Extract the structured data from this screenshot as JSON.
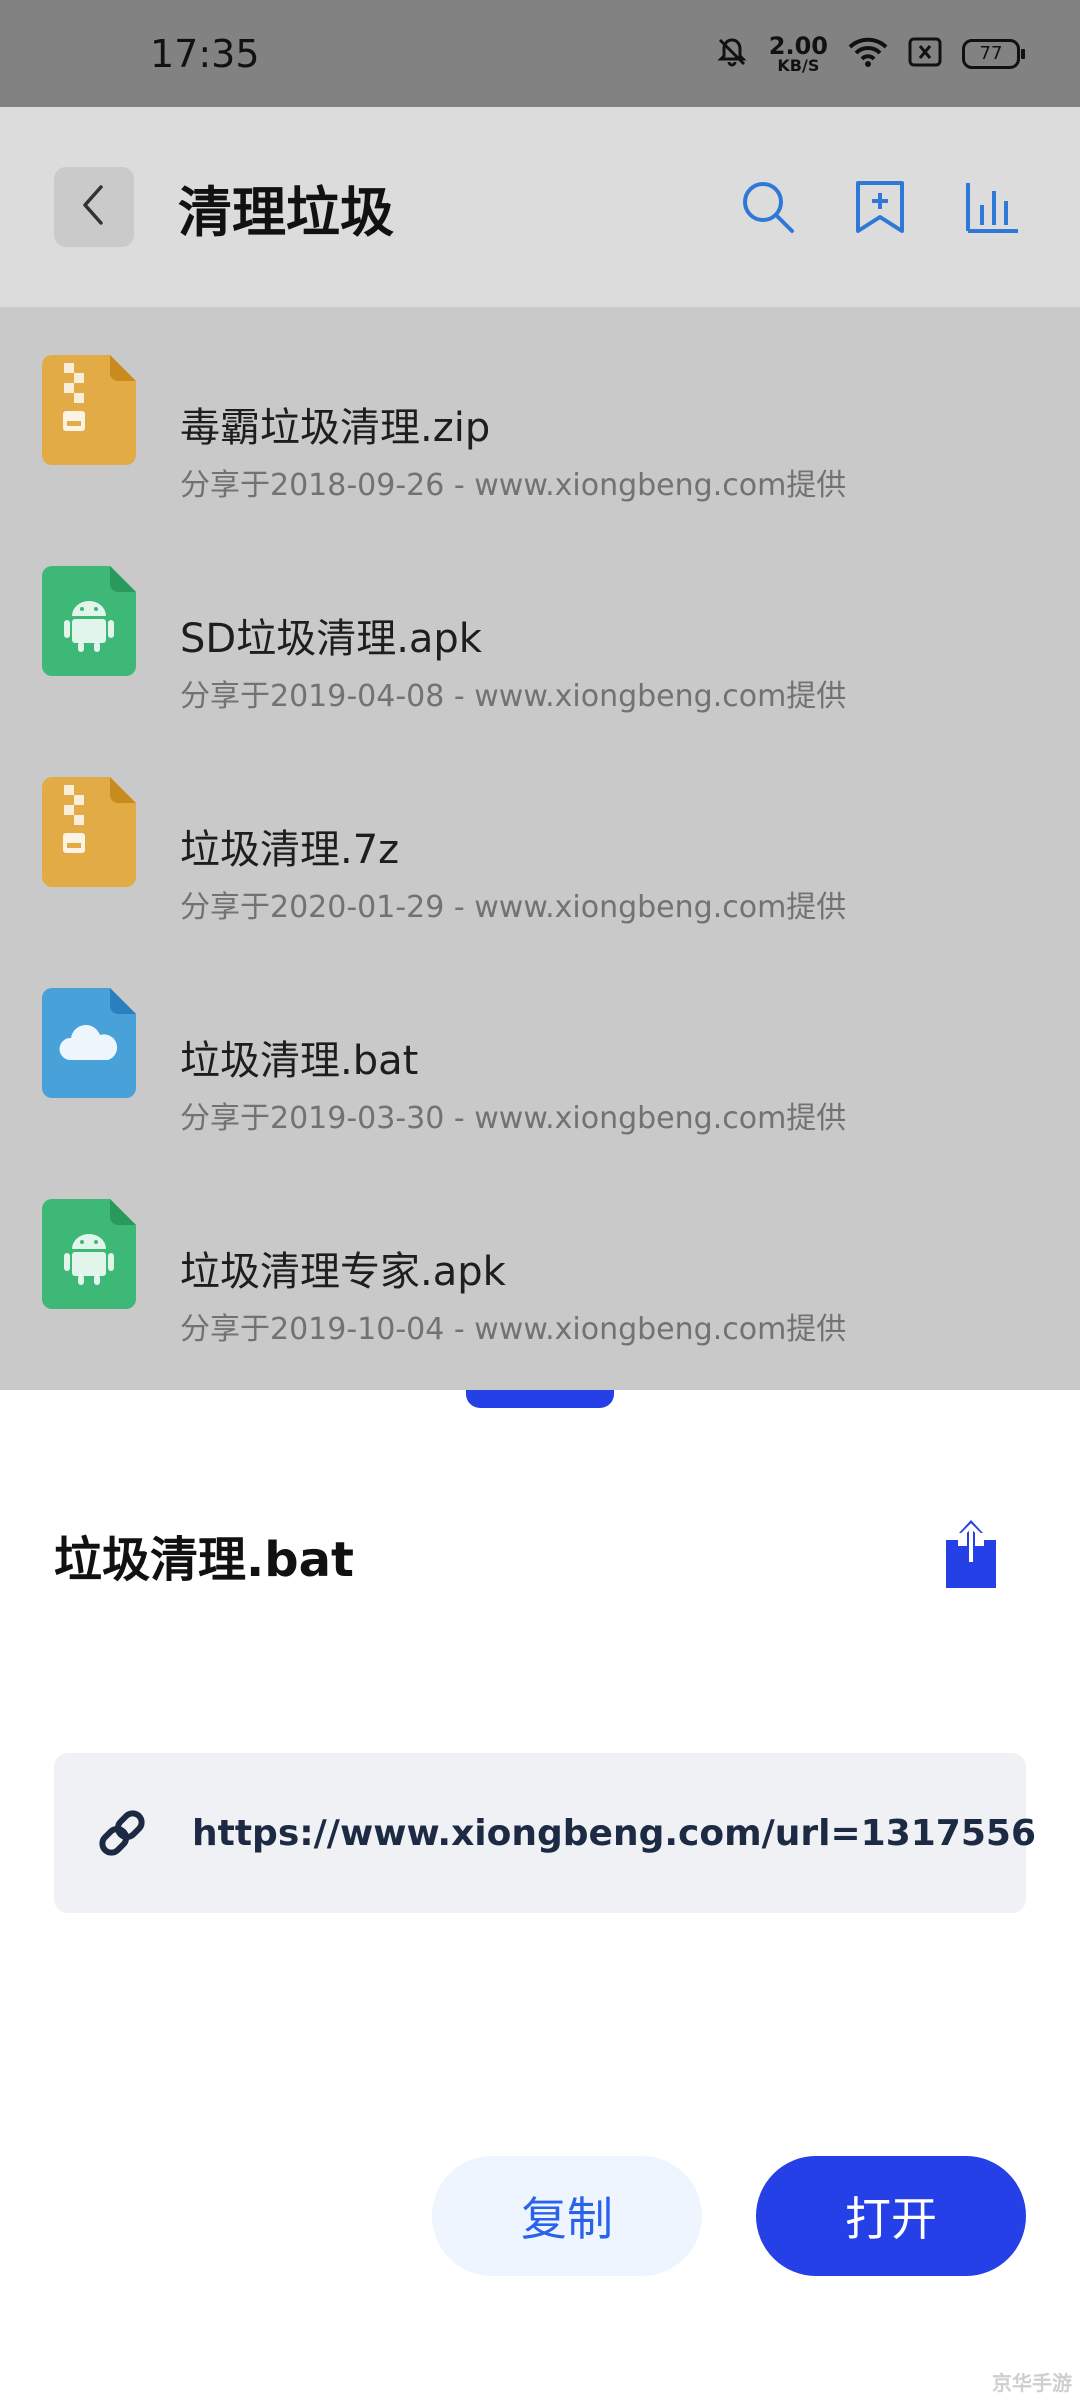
{
  "status_bar": {
    "time": "17:35",
    "net_speed": "2.00",
    "net_unit": "KB/S",
    "battery": "77"
  },
  "toolbar": {
    "title": "清理垃圾",
    "icons": [
      "back-icon",
      "search-icon",
      "bookmark-add-icon",
      "stats-icon"
    ],
    "accent": "#2f78d8"
  },
  "files": [
    {
      "name": "毒霸垃圾清理.zip",
      "meta": "分享于2018-09-26 - www.xiongbeng.com提供",
      "type": "zip",
      "color": "#e2ab45"
    },
    {
      "name": "SD垃圾清理.apk",
      "meta": "分享于2019-04-08 - www.xiongbeng.com提供",
      "type": "apk",
      "color": "#3db877"
    },
    {
      "name": "垃圾清理.7z",
      "meta": "分享于2020-01-29 - www.xiongbeng.com提供",
      "type": "zip",
      "color": "#e2ab45"
    },
    {
      "name": "垃圾清理.bat",
      "meta": "分享于2019-03-30 - www.xiongbeng.com提供",
      "type": "cloud",
      "color": "#48a1d9"
    },
    {
      "name": "垃圾清理专家.apk",
      "meta": "分享于2019-10-04 - www.xiongbeng.com提供",
      "type": "apk",
      "color": "#3db877"
    }
  ],
  "sheet": {
    "title": "垃圾清理.bat",
    "link": "https://www.xiongbeng.com/url=1317556",
    "copy_label": "复制",
    "open_label": "打开",
    "primary_color": "#2440e6"
  },
  "watermark": "京华手游"
}
